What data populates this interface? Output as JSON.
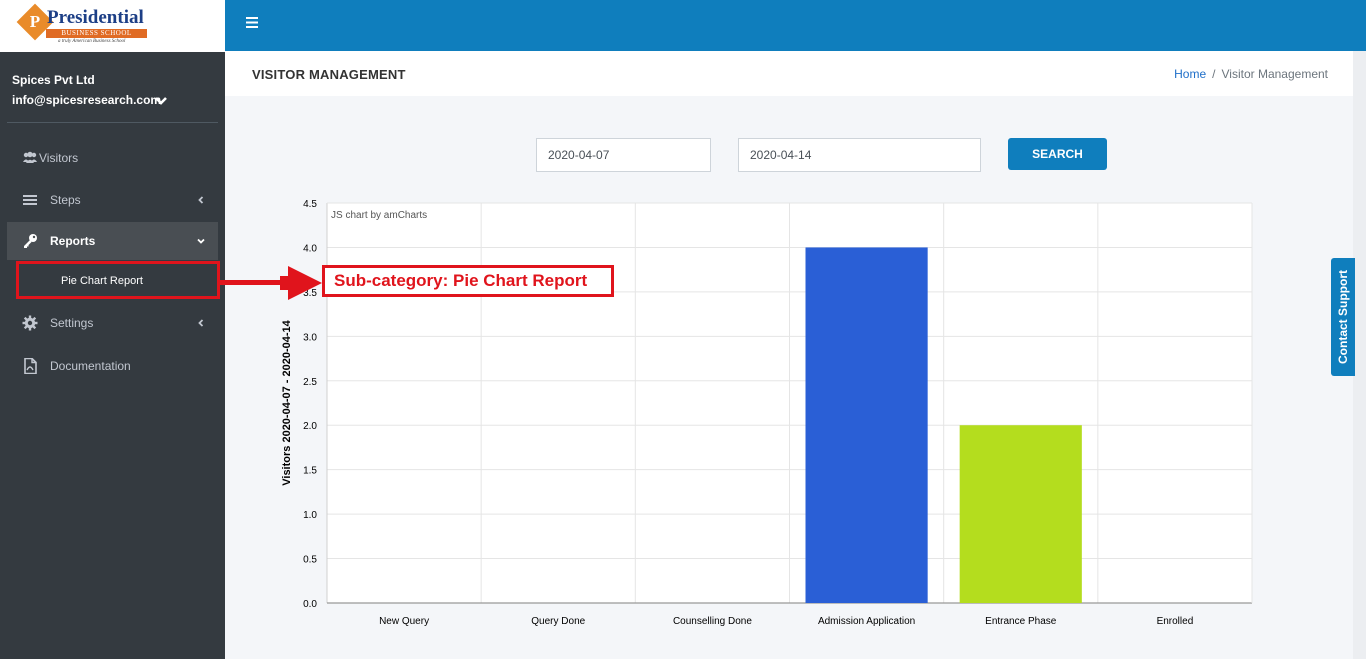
{
  "logo": {
    "letter": "P",
    "name": "Presidential",
    "subtitle": "BUSINESS SCHOOL",
    "tagline": "a truly American Business School"
  },
  "user": {
    "company": "Spices Pvt Ltd",
    "email": "info@spicesresearch.com"
  },
  "sidebar": {
    "items": [
      {
        "label": "Visitors",
        "icon": "users-icon"
      },
      {
        "label": "Steps",
        "icon": "list-icon"
      },
      {
        "label": "Reports",
        "icon": "key-icon"
      },
      {
        "label": "Settings",
        "icon": "gear-icon"
      },
      {
        "label": "Documentation",
        "icon": "file-pdf-icon"
      }
    ],
    "sub_item": "Pie Chart Report"
  },
  "header": {
    "title": "VISITOR MANAGEMENT"
  },
  "breadcrumb": {
    "home": "Home",
    "sep": "/",
    "current": "Visitor Management"
  },
  "filter": {
    "from_date": "2020-04-07",
    "to_date": "2020-04-14",
    "search_label": "SEARCH"
  },
  "annotation": {
    "label": "Sub-category: Pie Chart Report"
  },
  "contact": {
    "label": "Contact Support"
  },
  "colors": {
    "primary": "#0f7ebd",
    "sidebar": "#343a40",
    "annotation": "#e0141c"
  },
  "chart_data": {
    "type": "bar",
    "credit": "JS chart by amCharts",
    "ylabel": "Visitors 2020-04-07 - 2020-04-14",
    "categories": [
      "New Query",
      "Query Done",
      "Counselling Done",
      "Admission Application",
      "Entrance Phase",
      "Enrolled"
    ],
    "values": [
      0,
      0,
      0,
      4,
      2,
      0
    ],
    "colors": [
      "#67b7dc",
      "#fdd400",
      "#84b761",
      "#2a5fd6",
      "#b4dd1e",
      "#cc4748"
    ],
    "ylim": [
      0,
      4.5
    ],
    "yticks": [
      "0.0",
      "0.5",
      "1.0",
      "1.5",
      "2.0",
      "2.5",
      "3.0",
      "3.5",
      "4.0",
      "4.5"
    ],
    "grid": true
  }
}
